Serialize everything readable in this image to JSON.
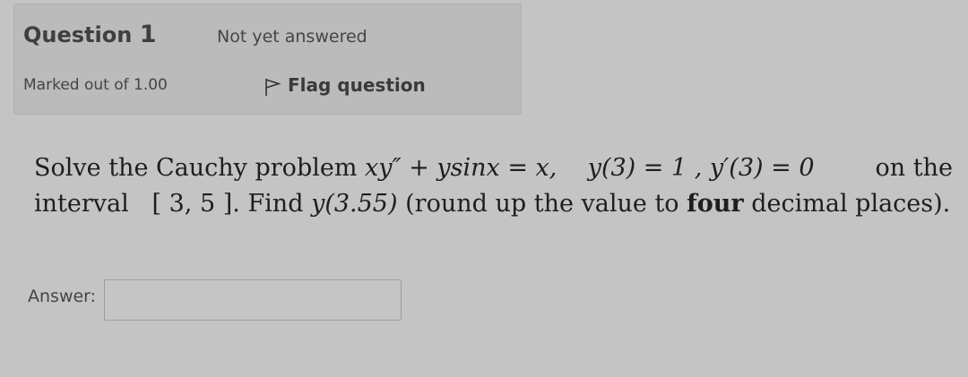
{
  "question": {
    "label": "Question",
    "number": "1",
    "state": "Not yet answered",
    "grade": "Marked out of 1.00",
    "flag_label": "Flag question"
  },
  "qtext": {
    "line1_intro": "Solve the Cauchy problem",
    "line1_equation": "xy″ + ysinx = x,",
    "line1_conditions": "y(3) = 1 , y′(3) = 0",
    "line1_end": "on the",
    "line2_start": "interval",
    "line2_interval": "[ 3, 5 ].",
    "line2_find": "Find",
    "line2_target": "y(3.55)",
    "line2_note_start": "(round up the value to",
    "line2_bold": "four",
    "line2_note_end": "decimal places)."
  },
  "answer": {
    "label": "Answer:",
    "value": ""
  },
  "icons": {
    "flag": "flag-icon"
  }
}
